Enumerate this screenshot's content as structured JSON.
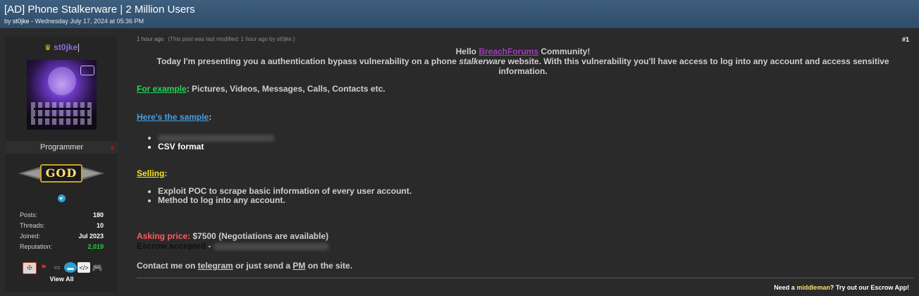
{
  "thread": {
    "title": "[AD] Phone Stalkerware | 2 Million Users",
    "by_prefix": "by ",
    "author": "st0jke",
    "date": " - Wednesday July 17, 2024 at 05:36 PM"
  },
  "user": {
    "name": "st0jke",
    "role": "Programmer",
    "rank_badge": "GOD",
    "stats": [
      {
        "label": "Posts:",
        "value": "180"
      },
      {
        "label": "Threads:",
        "value": "10"
      },
      {
        "label": "Joined:",
        "value": "Jul 2023"
      },
      {
        "label": "Reputation:",
        "value": "2,019"
      }
    ],
    "view_all": "View All"
  },
  "post": {
    "time": "1 hour ago",
    "modified_note": "(This post was last modified: 1 hour ago by st0jke.)",
    "number": "#1",
    "hello_prefix": "Hello ",
    "hello_link": "BreachForums",
    "hello_suffix": " Community!",
    "intro_a": "Today I'm presenting you a authentication bypass vulnerability on a phone ",
    "intro_em": "stalkerware",
    "intro_b": " website. With this vulnerability you'll have access to log into any account and access sensitive information.",
    "example_label": "For example",
    "example_text": ": Pictures, Videos, Messages, Calls, Contacts etc.",
    "sample_label": "Here's the sample",
    "sample_colon": ":",
    "csv_format": "CSV format",
    "selling_label": "Selling",
    "selling_colon": ":",
    "selling_items": [
      "Exploit POC to scrape basic information of every user account.",
      "Method to log into any account."
    ],
    "asking_label": "Asking price:",
    "asking_value": " $7500 (Negotiations are available)",
    "escrow_label": "Escrow accepted",
    "escrow_dash": " - ",
    "contact_prefix": "Contact me on ",
    "contact_telegram": "telegram",
    "contact_mid": " or just send a ",
    "contact_pm": "PM",
    "contact_suffix": " on the site."
  },
  "signature": {
    "prefix": "Need a ",
    "middleman": "middleman",
    "suffix": "? Try out our Escrow App!"
  },
  "colors": {
    "header": "#34536f",
    "background": "#2a2a2a",
    "green_link": "#26d35b",
    "blue_link": "#3fa2e8",
    "yellow_link": "#f7e21a",
    "purple_link": "#a638c5",
    "asking_red": "#ff5b5b",
    "reputation_green": "#2ecc40"
  }
}
